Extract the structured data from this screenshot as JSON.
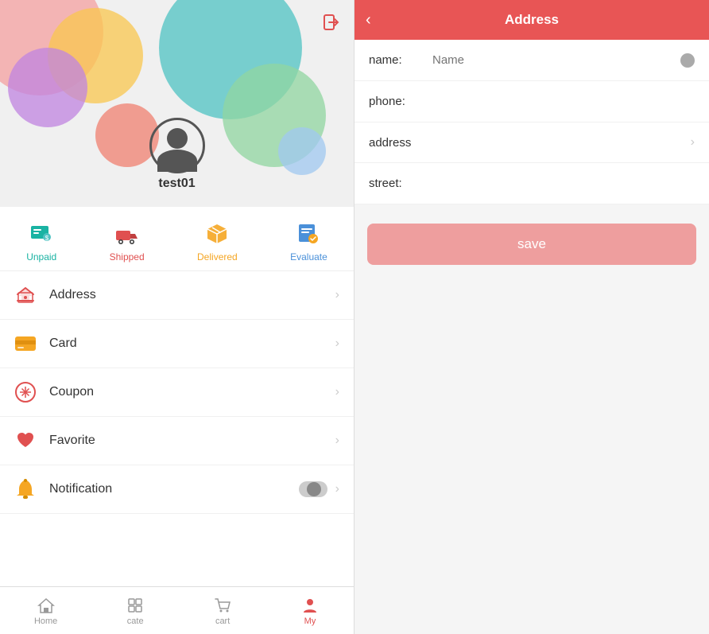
{
  "left": {
    "logout_icon": "⬛",
    "username": "test01",
    "order_tabs": [
      {
        "id": "unpaid",
        "label": "Unpaid",
        "color": "#1ab3a3"
      },
      {
        "id": "shipped",
        "label": "Shipped",
        "color": "#e05050"
      },
      {
        "id": "delivered",
        "label": "Delivered",
        "color": "#f5a623"
      },
      {
        "id": "evaluate",
        "label": "Evaluate",
        "color": "#4a90d9"
      }
    ],
    "menu_items": [
      {
        "id": "address",
        "label": "Address",
        "icon": "cart"
      },
      {
        "id": "card",
        "label": "Card",
        "icon": "card"
      },
      {
        "id": "coupon",
        "label": "Coupon",
        "icon": "coupon"
      },
      {
        "id": "favorite",
        "label": "Favorite",
        "icon": "heart"
      },
      {
        "id": "notification",
        "label": "Notification",
        "icon": "bell",
        "has_toggle": true
      }
    ],
    "bottom_nav": [
      {
        "id": "home",
        "label": "Home",
        "active": false
      },
      {
        "id": "cate",
        "label": "cate",
        "active": false
      },
      {
        "id": "cart",
        "label": "cart",
        "active": false
      },
      {
        "id": "my",
        "label": "My",
        "active": true
      }
    ]
  },
  "right": {
    "header": {
      "title": "Address",
      "back_label": "‹"
    },
    "form": {
      "name_label": "name:",
      "name_placeholder": "Name",
      "phone_label": "phone:",
      "address_label": "address",
      "street_label": "street:"
    },
    "save_button": "save"
  }
}
